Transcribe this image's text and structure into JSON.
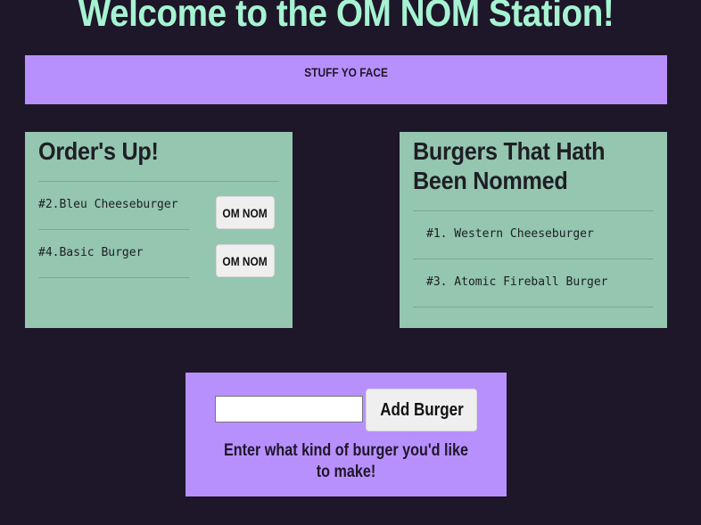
{
  "header": {
    "title": "Welcome to the OM NOM Station!"
  },
  "banner": {
    "label": "STUFF YO FACE"
  },
  "orders": {
    "title": "Order's Up!",
    "items": [
      {
        "label": "#2.Bleu Cheeseburger",
        "button": "OM NOM"
      },
      {
        "label": "#4.Basic Burger",
        "button": "OM NOM"
      }
    ]
  },
  "eaten": {
    "title": "Burgers That Hath Been Nommed",
    "items": [
      {
        "label": "#1. Western Cheeseburger"
      },
      {
        "label": "#3. Atomic Fireball Burger"
      }
    ]
  },
  "form": {
    "input_value": "",
    "input_placeholder": "",
    "button_label": "Add Burger",
    "hint": "Enter what kind of burger you'd like to make!"
  },
  "colors": {
    "background": "#1e1629",
    "title": "#a6f3d2",
    "accent_purple": "#b890fd",
    "panel_green": "#94c6b0"
  }
}
